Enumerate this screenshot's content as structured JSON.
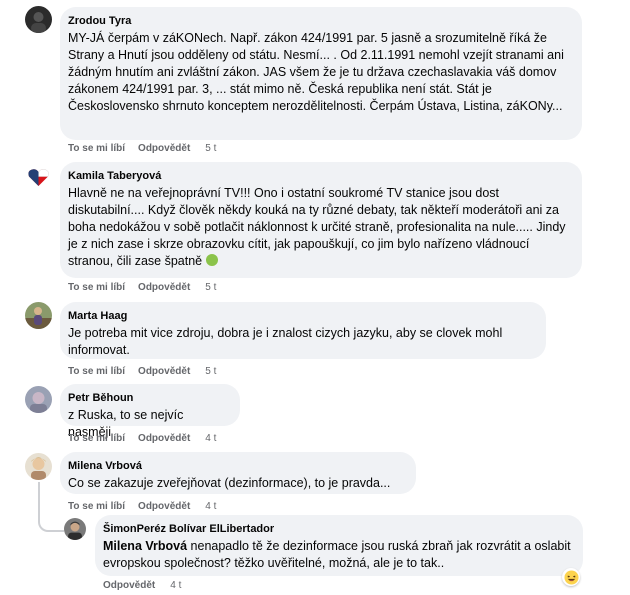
{
  "comments": [
    {
      "author": "Zrodou Tyra",
      "text": "MY-JÁ čerpám v záKONech. Např. zákon 424/1991 par. 5 jasně a srozumitelně říká že Strany a Hnutí jsou odděleny od státu. Nesmí... . Od 2.11.1991 nemohl vzejít stranami ani žádným hnutím ani zvláštní zákon. JAS všem že je tu država czechaslavakia váš domov zákonem 424/1991 par. 3, ... stát mimo ně. Česká republika není stát. Stát je Československo shrnuto konceptem nerozdělitelnosti. Čerpám Ústava, Listina, záKONy...",
      "like": "To se mi líbí",
      "reply": "Odpovědět",
      "time": "5 t",
      "avatar_icon": "dark-photo-avatar"
    },
    {
      "author": "Kamila Taberyová",
      "text": "Hlavně ne na veřejnoprávní TV!!! Ono i ostatní soukromé TV stanice jsou dost diskutabilní.... Když člověk někdy kouká na ty různé debaty, tak někteří moderátoři ani za boha nedokážou v sobě potlačit náklonnost k určité straně, profesionalita na nule..... Jindy je z nich zase i skrze obrazovku cítit, jak papouškují, co jim bylo nařízeno vládnoucí stranou, čili zase špatně",
      "emoji": "nauseated-face-icon",
      "like": "To se mi líbí",
      "reply": "Odpovědět",
      "time": "5 t",
      "avatar_icon": "czech-flag-heart-avatar"
    },
    {
      "author": "Marta Haag",
      "text": "Je potreba mit vice zdroju, dobra je i znalost cizych jazyku, aby se clovek mohl informovat.",
      "like": "To se mi líbí",
      "reply": "Odpovědět",
      "time": "5 t",
      "avatar_icon": "outdoor-photo-avatar"
    },
    {
      "author": "Petr Běhoun",
      "text": "z Ruska, to se nejvíc nasměji",
      "like": "To se mi líbí",
      "reply": "Odpovědět",
      "time": "4 t",
      "avatar_icon": "blurred-photo-avatar"
    },
    {
      "author": "Milena Vrbová",
      "text": "Co se zakazuje zveřejňovat (dezinformace), to je pravda...",
      "like": "To se mi líbí",
      "reply": "Odpovědět",
      "time": "4 t",
      "avatar_icon": "portrait-photo-avatar"
    }
  ],
  "reply": {
    "author": "ŠimonPeréz Bolívar ElLibertador",
    "mention": "Milena Vrbová",
    "text": " nenapadlo tě že dezinformace jsou ruská zbraň jak rozvrátit a oslabit evropskou společnost? těžko uvěřitelné, možná, ale je to tak..",
    "reply": "Odpovědět",
    "time": "4 t",
    "reaction": "laughing-face-icon",
    "avatar_icon": "man-photo-avatar"
  }
}
